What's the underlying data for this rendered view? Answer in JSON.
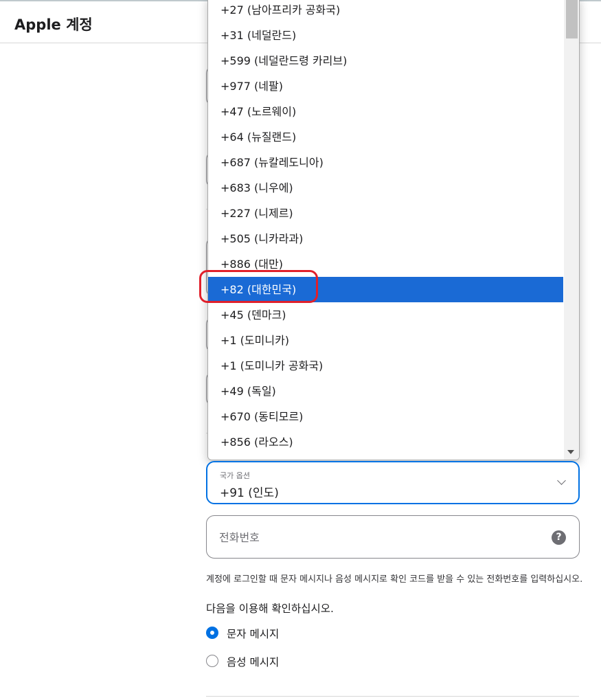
{
  "header": {
    "title": "Apple 계정"
  },
  "dropdown": {
    "options": [
      "+27 (남아프리카 공화국)",
      "+31 (네덜란드)",
      "+599 (네덜란드령 카리브)",
      "+977 (네팔)",
      "+47 (노르웨이)",
      "+64 (뉴질랜드)",
      "+687 (뉴칼레도니아)",
      "+683 (니우에)",
      "+227 (니제르)",
      "+505 (니카라과)",
      "+886 (대만)",
      "+82 (대한민국)",
      "+45 (덴마크)",
      "+1 (도미니카)",
      "+1 (도미니카 공화국)",
      "+49 (독일)",
      "+670 (동티모르)",
      "+856 (라오스)"
    ],
    "selected": "+82 (대한민국)"
  },
  "country_select": {
    "label": "국가 옵션",
    "value": "+91 (인도)"
  },
  "phone": {
    "placeholder": "전화번호",
    "help": "?"
  },
  "hint": "계정에 로그인할 때 문자 메시지나 음성 메시지로 확인 코드를 받을 수 있는 전화번호를 입력하십시오.",
  "verify": {
    "title": "다음을 이용해 확인하십시오.",
    "options": [
      {
        "label": "문자 메시지",
        "checked": true
      },
      {
        "label": "음성 메시지",
        "checked": false
      }
    ]
  },
  "colors": {
    "accent": "#0071e3",
    "selected_row": "#1a6ad5",
    "annotation": "#e0202b"
  }
}
